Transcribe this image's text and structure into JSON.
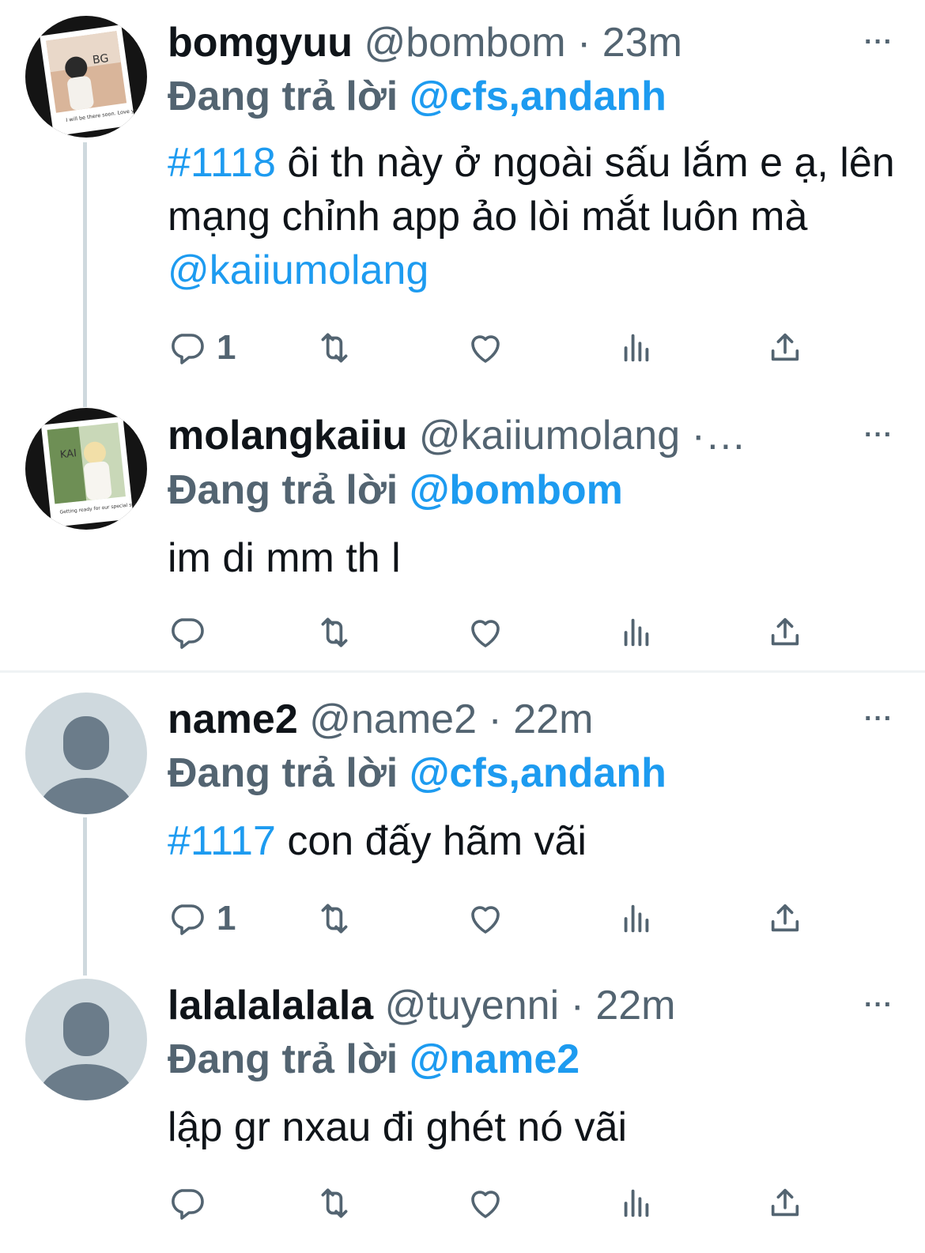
{
  "colors": {
    "accent": "#1d9bf0",
    "secondary_text": "#536471",
    "primary_text": "#0f1419",
    "default_avatar": "#cfd9de"
  },
  "reply_prefix": "Đang trả lời",
  "tweets": [
    {
      "name": "bomgyuu",
      "handle": "@bombom",
      "separator": " · ",
      "time": "23m",
      "more_icon": "···",
      "reply_to": "@cfs,andanh",
      "hashtag": "#1118",
      "text": " ôi th này ở ngoài sấu lắm e ạ, lên mạng chỉnh app ảo lòi mắt luôn mà ",
      "mention": "@kaiiumolang",
      "reply_count": "1",
      "avatar": "photo",
      "avatar_caption": "I will be there soon. Love you MoA!"
    },
    {
      "name": "molangkaiiu",
      "handle": "@kaiiumolang",
      "separator": " ·…",
      "time": "",
      "more_icon": "···",
      "reply_to": "@bombom",
      "text": "im di mm th l",
      "reply_count": "",
      "avatar": "photo",
      "avatar_caption": "Getting ready for our special summer together?"
    },
    {
      "name": "name2",
      "handle": "@name2",
      "separator": " · ",
      "time": "22m",
      "more_icon": "···",
      "reply_to": "@cfs,andanh",
      "hashtag": "#1117",
      "text": " con đấy hãm vãi",
      "reply_count": "1",
      "avatar": "default"
    },
    {
      "name": "lalalalalala",
      "handle": "@tuyenni",
      "separator": " · ",
      "time": "22m",
      "more_icon": "···",
      "reply_to": "@name2",
      "text": "lập gr nxau đi ghét nó vãi",
      "reply_count": "",
      "avatar": "default"
    }
  ],
  "action_icons": [
    "reply-icon",
    "retweet-icon",
    "like-icon",
    "views-icon",
    "share-icon"
  ]
}
